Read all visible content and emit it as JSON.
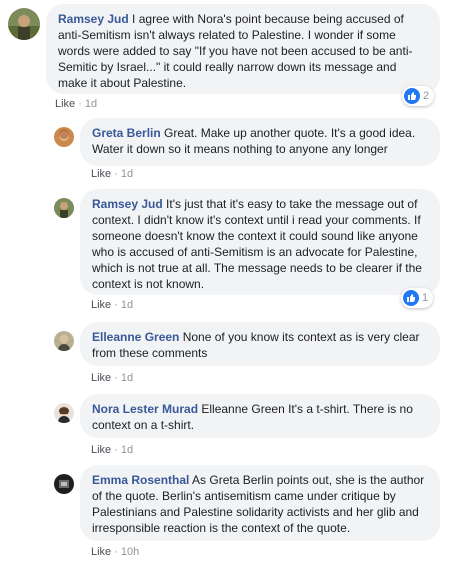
{
  "comments": [
    {
      "author": "Ramsey Jud",
      "text": "I agree with Nora's point because being accused of anti-Semitism isn't always related to Palestine. I wonder if some words were added to say \"If you have not been accused to be anti-Semitic by Israel...\" it could really narrow down its message and make it about Palestine.",
      "like_label": "Like",
      "time": "1d",
      "reaction_count": "2"
    },
    {
      "author": "Greta Berlin",
      "text": "Great. Make up another quote. It's a good idea. Water it down so it means nothing to anyone any longer",
      "like_label": "Like",
      "time": "1d"
    },
    {
      "author": "Ramsey Jud",
      "text": "It's just that it's easy to take the message out of context. I didn't know it's context until i read your comments. If someone doesn't know the context it could sound like anyone who is accused of anti-Semitism is an advocate for Palestine, which is not true at all. The message needs to be clearer if the context is not known.",
      "like_label": "Like",
      "time": "1d",
      "reaction_count": "1"
    },
    {
      "author": "Elleanne Green",
      "text": "None of you know its context as is very clear from these comments",
      "like_label": "Like",
      "time": "1d"
    },
    {
      "author": "Nora Lester Murad",
      "text": "Elleanne Green It's a t-shirt. There is no context on a t-shirt.",
      "like_label": "Like",
      "time": "1d"
    },
    {
      "author": "Emma Rosenthal",
      "text": "As Greta Berlin points out, she is the author of the quote. Berlin's antisemitism came under critique by Palestinians and Palestine solidarity activists and her glib and irresponsible reaction is the context of the quote.",
      "like_label": "Like",
      "time": "10h"
    }
  ],
  "colors": {
    "author": "#385898",
    "bubble": "#f2f3f5",
    "like_icon": "#2078f4",
    "meta": "#90949c"
  }
}
